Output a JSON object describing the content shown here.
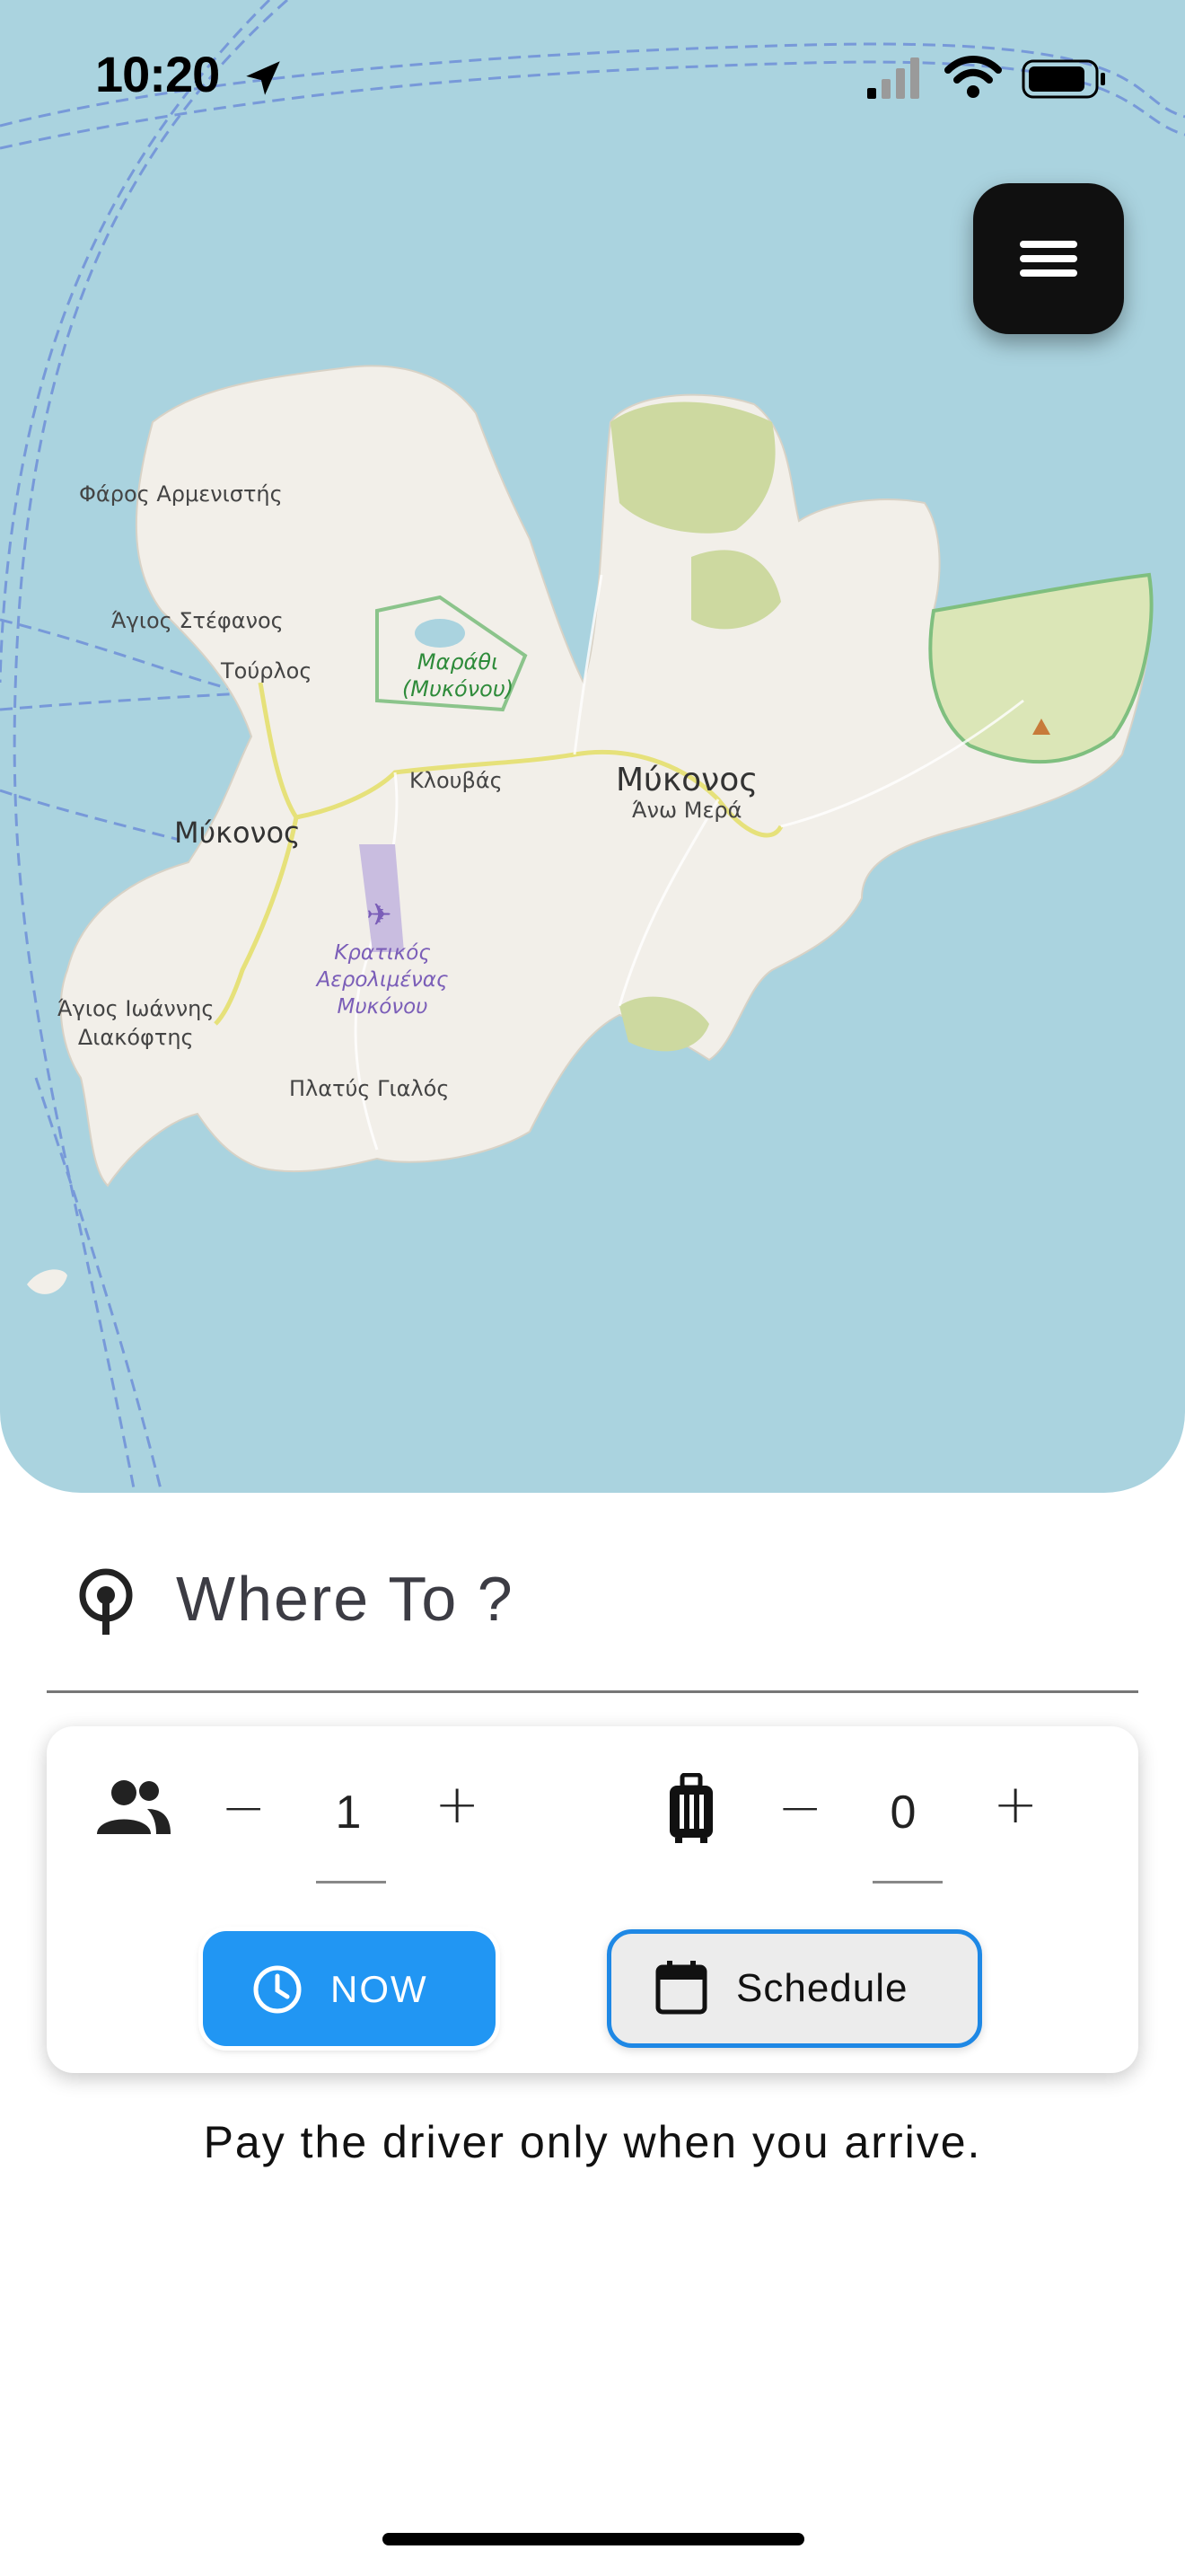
{
  "status_bar": {
    "time": "10:20",
    "icons": [
      "location-arrow-icon",
      "cellular-signal-icon",
      "wifi-icon",
      "battery-icon"
    ]
  },
  "map": {
    "labels": {
      "faros": "Φάρος Αρμενιστής",
      "agios_stefanos": "Άγιος Στέφανος",
      "tourlos": "Τούρλος",
      "marathi_1": "Μαράθι",
      "marathi_2": "(Μυκόνου)",
      "klouvas": "Κλουβάς",
      "mykonos_east": "Μύκονος",
      "ano_mera": "Άνω Μερά",
      "mykonos_town": "Μύκονος",
      "airport_1": "Κρατικός",
      "airport_2": "Αερολιμένας",
      "airport_3": "Μυκόνου",
      "agios_ioannis_1": "Άγιος Ιωάννης",
      "agios_ioannis_2": "Διακόφτης",
      "platys_gialos": "Πλατύς Γιαλός"
    },
    "colors": {
      "sea": "#aad3df",
      "land": "#f2efe9",
      "green": "#cdd9a0",
      "road": "#f6f3a8"
    }
  },
  "menu": {
    "icon": "hamburger-menu-icon"
  },
  "search": {
    "placeholder": "Where To ?",
    "icon": "location-pin-icon"
  },
  "booking": {
    "passengers": {
      "icon": "people-icon",
      "count": "1",
      "minus": "−",
      "plus": "+"
    },
    "luggage": {
      "icon": "luggage-icon",
      "count": "0",
      "minus": "−",
      "plus": "+"
    },
    "now_button": {
      "label": "NOW",
      "icon": "clock-icon",
      "color": "#2196f3"
    },
    "schedule_button": {
      "label": "Schedule",
      "icon": "calendar-icon",
      "border_color": "#1e88e5"
    }
  },
  "footer_note": "Pay the driver only when you arrive."
}
